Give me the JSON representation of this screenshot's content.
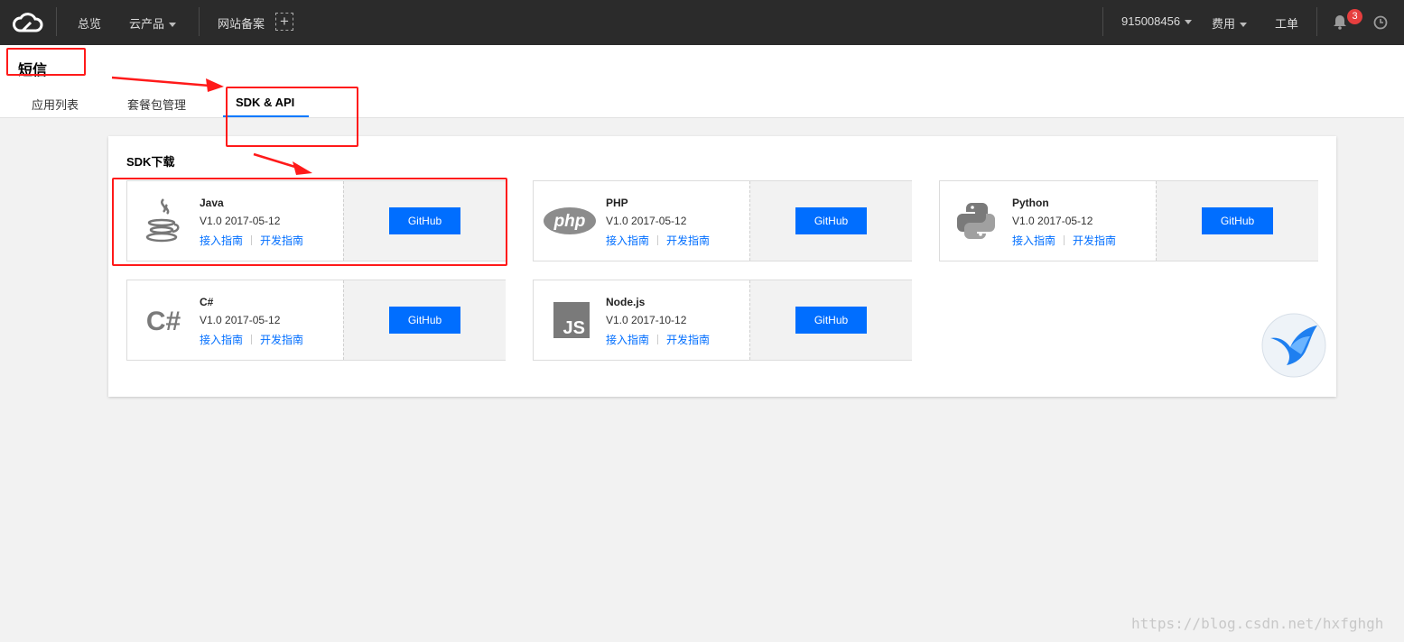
{
  "topbar": {
    "overview": "总览",
    "products": "云产品",
    "icp": "网站备案",
    "account": "915008456",
    "billing": "费用",
    "tickets": "工单",
    "notifications_count": "3"
  },
  "page": {
    "title": "短信"
  },
  "tabs": [
    {
      "label": "应用列表"
    },
    {
      "label": "套餐包管理"
    },
    {
      "label": "SDK & API"
    }
  ],
  "sdk_section": {
    "title": "SDK下载",
    "github_label": "GitHub",
    "guide_access": "接入指南",
    "guide_dev": "开发指南",
    "items": [
      {
        "name": "Java",
        "version": "V1.0 2017-05-12",
        "icon": "java-icon"
      },
      {
        "name": "PHP",
        "version": "V1.0 2017-05-12",
        "icon": "php-icon"
      },
      {
        "name": "Python",
        "version": "V1.0 2017-05-12",
        "icon": "python-icon"
      },
      {
        "name": "C#",
        "version": "V1.0 2017-05-12",
        "icon": "csharp-icon"
      },
      {
        "name": "Node.js",
        "version": "V1.0 2017-10-12",
        "icon": "nodejs-icon"
      }
    ]
  },
  "watermark": "https://blog.csdn.net/hxfghgh",
  "colors": {
    "accent": "#006eff",
    "topbar": "#2b2b2b",
    "annotation": "#ff1a1a"
  }
}
